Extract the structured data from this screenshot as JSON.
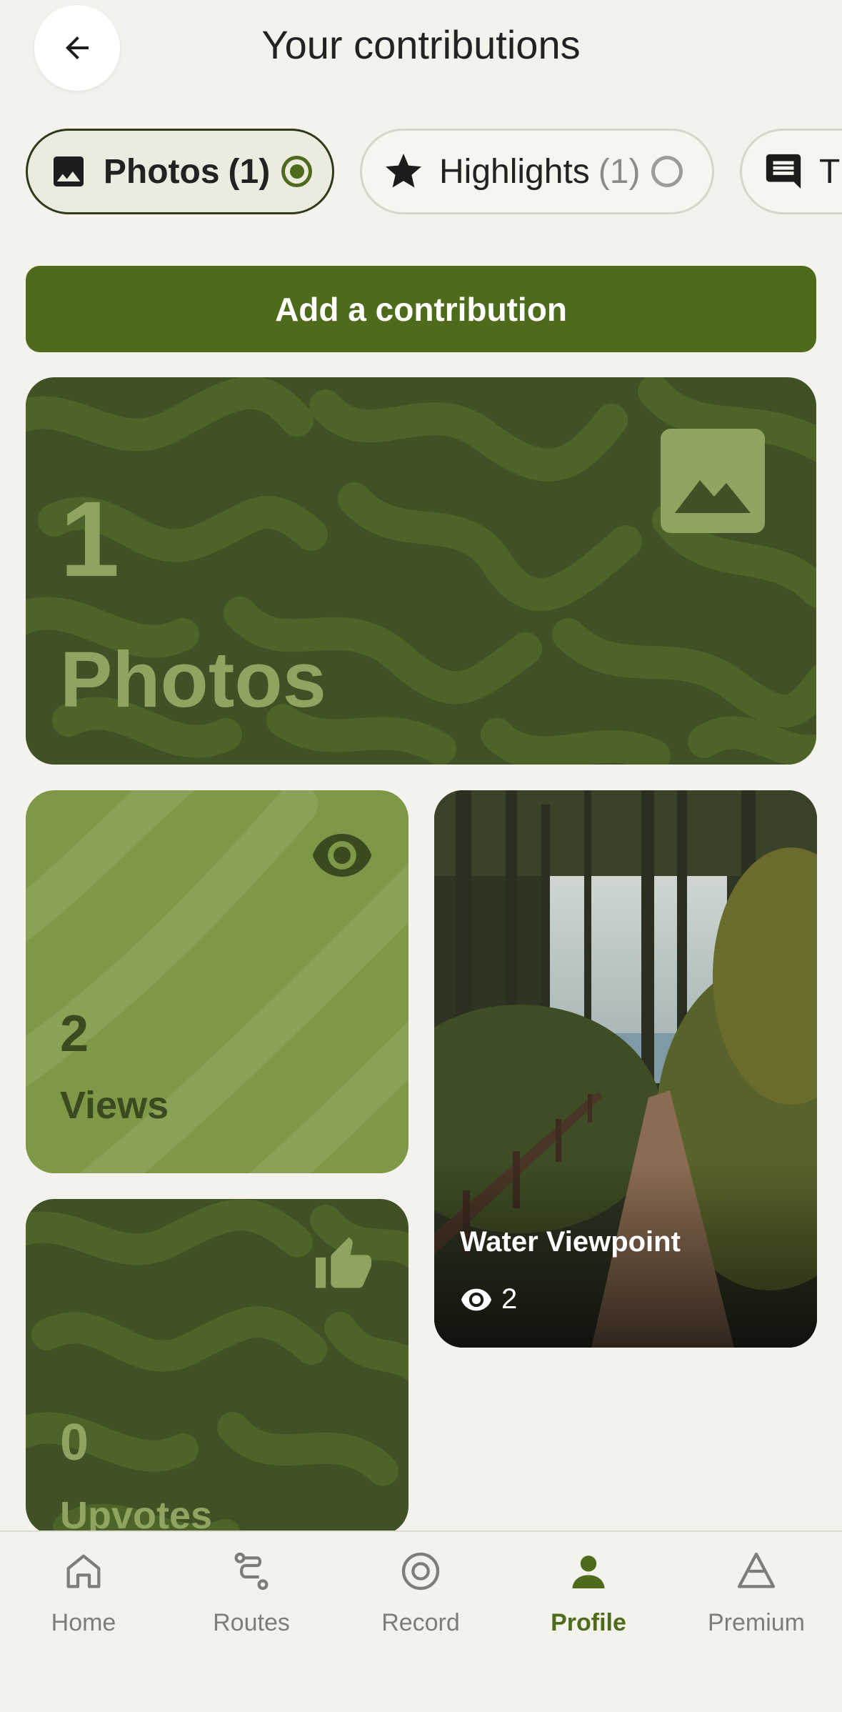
{
  "header": {
    "title": "Your contributions",
    "back_icon": "arrow-left-icon"
  },
  "chips": [
    {
      "label": "Photos",
      "count": "(1)",
      "icon": "image-icon",
      "selected": true
    },
    {
      "label": "Highlights",
      "count": "(1)",
      "icon": "star-icon",
      "selected": false
    },
    {
      "label": "T",
      "count": "",
      "icon": "comment-icon",
      "selected": false
    }
  ],
  "add_button": {
    "label": "Add a contribution"
  },
  "stats": {
    "photos": {
      "value": "1",
      "label": "Photos",
      "icon": "image-icon"
    },
    "views": {
      "value": "2",
      "label": "Views",
      "icon": "eye-icon"
    },
    "upvotes": {
      "value": "0",
      "label": "Upvotes",
      "icon": "thumbs-up-icon"
    }
  },
  "photo_card": {
    "title": "Water Viewpoint",
    "views": "2",
    "icon": "eye-icon"
  },
  "nav": [
    {
      "label": "Home",
      "icon": "home-icon",
      "active": false
    },
    {
      "label": "Routes",
      "icon": "route-icon",
      "active": false
    },
    {
      "label": "Record",
      "icon": "record-icon",
      "active": false
    },
    {
      "label": "Profile",
      "icon": "profile-icon",
      "active": true
    },
    {
      "label": "Premium",
      "icon": "premium-icon",
      "active": false
    }
  ],
  "colors": {
    "accent": "#4e6a1b",
    "dark_green": "#3f5125",
    "light_green": "#7e9848",
    "muted_green": "#8fa460",
    "background": "#f3f2ec"
  }
}
